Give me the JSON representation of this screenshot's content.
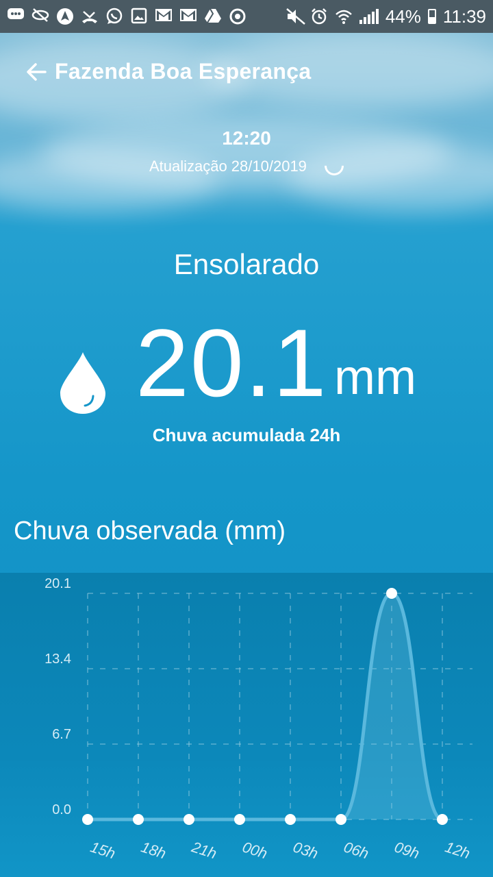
{
  "status_bar": {
    "battery": "44%",
    "time": "11:39",
    "left_icons": [
      "message-icon",
      "eye-off-icon",
      "navigation-icon",
      "missed-call-icon",
      "whatsapp-icon",
      "image-icon",
      "gmail-icon",
      "gmail-icon",
      "drive-icon",
      "sync-icon"
    ],
    "right_icons": [
      "mute-icon",
      "alarm-icon",
      "wifi-icon",
      "signal-icon",
      "battery-icon"
    ]
  },
  "header": {
    "title": "Fazenda Boa Esperança"
  },
  "update": {
    "time": "12:20",
    "label": "Atualização 28/10/2019"
  },
  "condition": "Ensolarado",
  "rain": {
    "value": "20.1",
    "unit": "mm",
    "label": "Chuva acumulada 24h"
  },
  "section_title": "Chuva observada (mm)",
  "chart_data": {
    "type": "line",
    "categories": [
      "15h",
      "18h",
      "21h",
      "00h",
      "03h",
      "06h",
      "09h",
      "12h"
    ],
    "values": [
      0.0,
      0.0,
      0.0,
      0.0,
      0.0,
      0.0,
      20.1,
      0.0
    ],
    "y_ticks": [
      "0.0",
      "6.7",
      "13.4",
      "20.1"
    ],
    "ylim": [
      0,
      20.1
    ],
    "grid": true,
    "colors": {
      "line": "#5ab8dd",
      "point": "#ffffff",
      "grid": "#9ccfe3"
    }
  }
}
